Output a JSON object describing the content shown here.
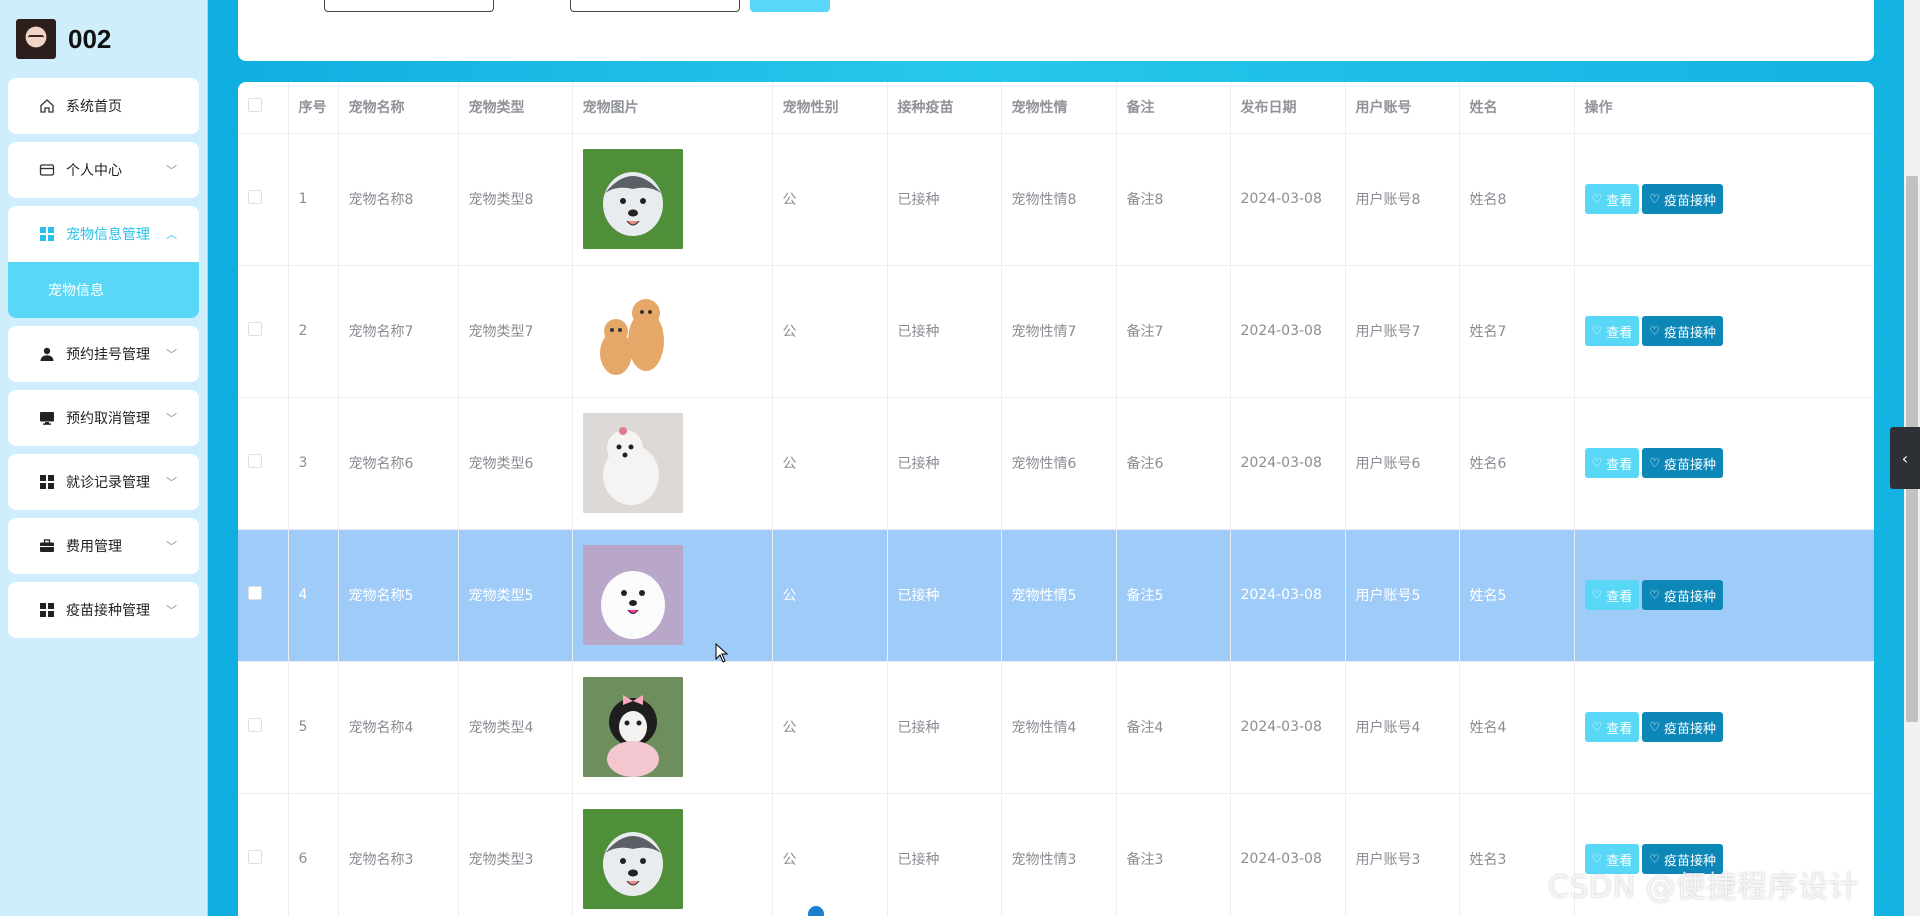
{
  "user": {
    "name": "002"
  },
  "sidebar": {
    "items": [
      {
        "label": "系统首页",
        "icon": "home-icon"
      },
      {
        "label": "个人中心",
        "icon": "wallet-icon",
        "expandable": true
      },
      {
        "label": "宠物信息管理",
        "icon": "grid-icon",
        "expandable": true,
        "expanded": true,
        "children": [
          {
            "label": "宠物信息"
          }
        ]
      },
      {
        "label": "预约挂号管理",
        "icon": "user-icon",
        "expandable": true
      },
      {
        "label": "预约取消管理",
        "icon": "monitor-icon",
        "expandable": true
      },
      {
        "label": "就诊记录管理",
        "icon": "grid-icon",
        "expandable": true
      },
      {
        "label": "费用管理",
        "icon": "briefcase-icon",
        "expandable": true
      },
      {
        "label": "疫苗接种管理",
        "icon": "grid-icon",
        "expandable": true
      }
    ]
  },
  "table": {
    "headers": [
      "序号",
      "宠物名称",
      "宠物类型",
      "宠物图片",
      "宠物性别",
      "接种疫苗",
      "宠物性情",
      "备注",
      "发布日期",
      "用户账号",
      "姓名",
      "操作"
    ],
    "view_label": "查看",
    "vaccinate_label": "疫苗接种",
    "rows": [
      {
        "index": "1",
        "name": "宠物名称8",
        "type": "宠物类型8",
        "image": "husky-puppy",
        "gender": "公",
        "vaccine": "已接种",
        "temperament": "宠物性情8",
        "note": "备注8",
        "date": "2024-03-08",
        "account": "用户账号8",
        "real_name": "姓名8",
        "selected": false
      },
      {
        "index": "2",
        "name": "宠物名称7",
        "type": "宠物类型7",
        "image": "two-kittens",
        "gender": "公",
        "vaccine": "已接种",
        "temperament": "宠物性情7",
        "note": "备注7",
        "date": "2024-03-08",
        "account": "用户账号7",
        "real_name": "姓名7",
        "selected": false
      },
      {
        "index": "3",
        "name": "宠物名称6",
        "type": "宠物类型6",
        "image": "white-puppy",
        "gender": "公",
        "vaccine": "已接种",
        "temperament": "宠物性情6",
        "note": "备注6",
        "date": "2024-03-08",
        "account": "用户账号6",
        "real_name": "姓名6",
        "selected": false
      },
      {
        "index": "4",
        "name": "宠物名称5",
        "type": "宠物类型5",
        "image": "samoyed-puppy",
        "gender": "公",
        "vaccine": "已接种",
        "temperament": "宠物性情5",
        "note": "备注5",
        "date": "2024-03-08",
        "account": "用户账号5",
        "real_name": "姓名5",
        "selected": true
      },
      {
        "index": "5",
        "name": "宠物名称4",
        "type": "宠物类型4",
        "image": "poodle-with-bow",
        "gender": "公",
        "vaccine": "已接种",
        "temperament": "宠物性情4",
        "note": "备注4",
        "date": "2024-03-08",
        "account": "用户账号4",
        "real_name": "姓名4",
        "selected": false
      },
      {
        "index": "6",
        "name": "宠物名称3",
        "type": "宠物类型3",
        "image": "husky-puppy",
        "gender": "公",
        "vaccine": "已接种",
        "temperament": "宠物性情3",
        "note": "备注3",
        "date": "2024-03-08",
        "account": "用户账号3",
        "real_name": "姓名3",
        "selected": false
      }
    ]
  },
  "watermark": "CSDN @便捷程序设计",
  "colors": {
    "accent": "#58d8f6",
    "dark_button": "#0d87b8",
    "selected_row": "#9fcbf8",
    "sidebar_bg": "#cdeefa"
  }
}
